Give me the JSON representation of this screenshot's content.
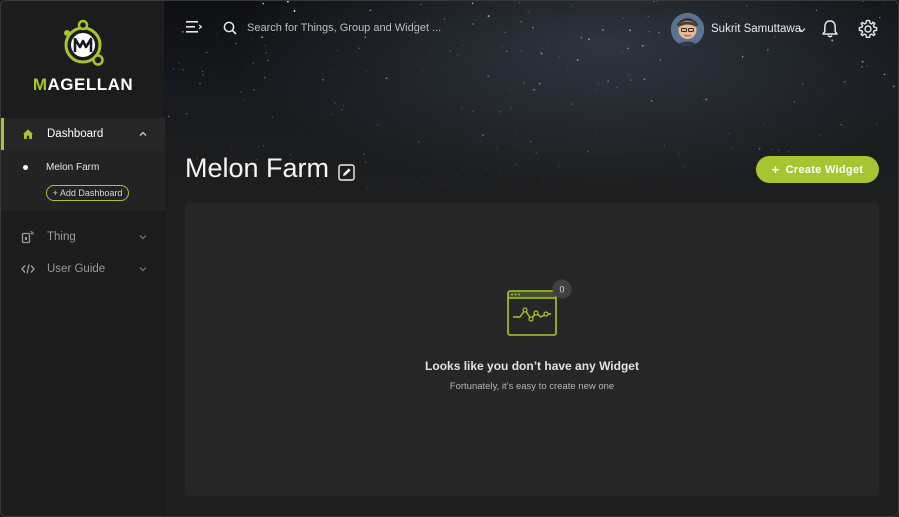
{
  "brand": {
    "logo_prefix": "M",
    "logo_rest": "AGELLAN",
    "accent_color": "#a6c631"
  },
  "sidebar": {
    "items": [
      {
        "label": "Dashboard",
        "icon": "home-icon",
        "active": true,
        "expanded": true
      },
      {
        "label": "Thing",
        "icon": "device-icon",
        "active": false,
        "expanded": false
      },
      {
        "label": "User Guide",
        "icon": "code-icon",
        "active": false,
        "expanded": false
      }
    ],
    "dashboards": [
      {
        "label": "Melon Farm"
      }
    ],
    "add_dashboard_label": "+ Add Dashboard"
  },
  "header": {
    "search_placeholder": "Search for Things, Group and Widget ...",
    "user_name": "Sukrit Samuttawa"
  },
  "page": {
    "title": "Melon Farm",
    "create_button_label": "Create Widget"
  },
  "empty_state": {
    "badge_count": "0",
    "title": "Looks like you don’t have any Widget",
    "subtitle": "Fortunately, it’s easy to create new one"
  }
}
